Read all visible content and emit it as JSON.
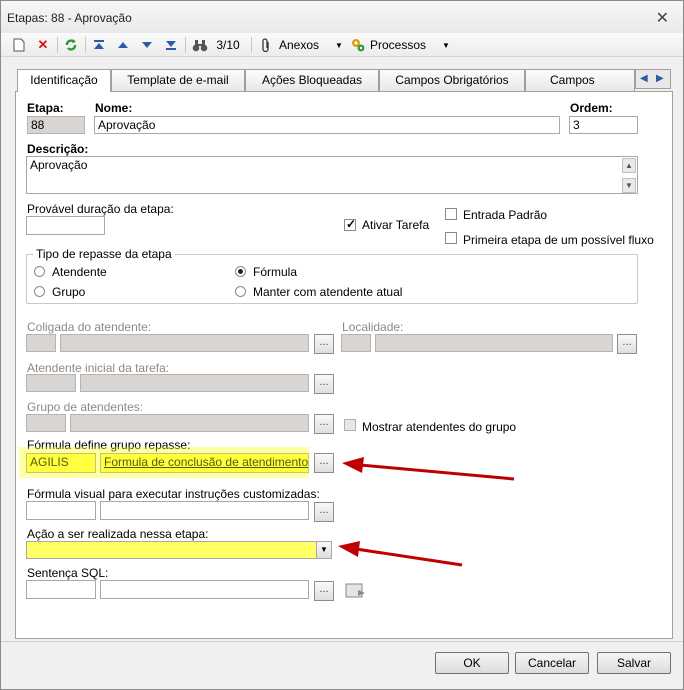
{
  "window": {
    "title": "Etapas: 88 - Aprovação"
  },
  "toolbar": {
    "record_counter": "3/10",
    "anexos_label": "Anexos",
    "processos_label": "Processos"
  },
  "tabs": [
    {
      "label": "Identificação",
      "active": true
    },
    {
      "label": "Template de e-mail"
    },
    {
      "label": "Ações Bloqueadas"
    },
    {
      "label": "Campos Obrigatórios"
    },
    {
      "label": "Campos Invisíve"
    }
  ],
  "form": {
    "etapa_label": "Etapa:",
    "etapa_value": "88",
    "nome_label": "Nome:",
    "nome_value": "Aprovação",
    "ordem_label": "Ordem:",
    "ordem_value": "3",
    "descricao_label": "Descrição:",
    "descricao_value": "Aprovação",
    "duracao_label": "Provável duração da etapa:",
    "ativar_tarefa_label": "Ativar Tarefa",
    "entrada_padrao_label": "Entrada Padrão",
    "primeira_etapa_label": "Primeira etapa de um possível fluxo",
    "tipo_repasse_title": "Tipo de repasse da etapa",
    "radio_atendente": "Atendente",
    "radio_grupo": "Grupo",
    "radio_formula": "Fórmula",
    "radio_manter": "Manter com atendente atual",
    "coligada_label": "Coligada do atendente:",
    "localidade_label": "Localidade:",
    "atendente_inicial_label": "Atendente inicial da tarefa:",
    "grupo_atendentes_label": "Grupo de atendentes:",
    "mostrar_atendentes_label": "Mostrar atendentes do grupo",
    "formula_grupo_label": "Fórmula define grupo repasse:",
    "formula_grupo_code": "AGILIS",
    "formula_grupo_desc": "Formula de conclusão de atendimento",
    "formula_visual_label": "Fórmula visual para executar instruções customizadas:",
    "acao_label": "Ação a ser realizada nessa etapa:",
    "sentenca_label": "Sentença SQL:",
    "dots": "..."
  },
  "buttons": {
    "ok": "OK",
    "cancel": "Cancelar",
    "save": "Salvar"
  },
  "colors": {
    "highlight": "#ffff66",
    "arrow": "#c00000"
  }
}
